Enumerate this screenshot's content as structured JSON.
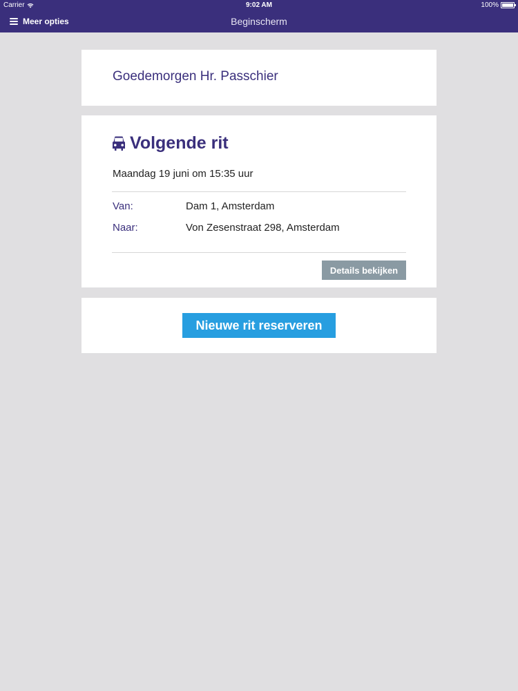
{
  "status_bar": {
    "carrier": "Carrier",
    "time": "9:02 AM",
    "battery": "100%",
    "battery_level": 1.0,
    "wifi_icon": "wifi-icon"
  },
  "nav": {
    "menu_label": "Meer opties",
    "title": "Beginscherm",
    "menu_icon": "hamburger-icon"
  },
  "greeting": "Goedemorgen Hr. Passchier",
  "next_ride": {
    "icon": "car-icon",
    "title": "Volgende rit",
    "date": "Maandag 19 juni om 15:35 uur",
    "from_label": "Van:",
    "from_value": "Dam 1, Amsterdam",
    "to_label": "Naar:",
    "to_value": "Von Zesenstraat 298, Amsterdam",
    "details_button": "Details bekijken"
  },
  "reserve_button": "Nieuwe rit reserveren",
  "colors": {
    "brand": "#3a2f7c",
    "primary_button": "#279ee0",
    "secondary_button": "#8a9aa3",
    "background": "#e0dfe1"
  }
}
